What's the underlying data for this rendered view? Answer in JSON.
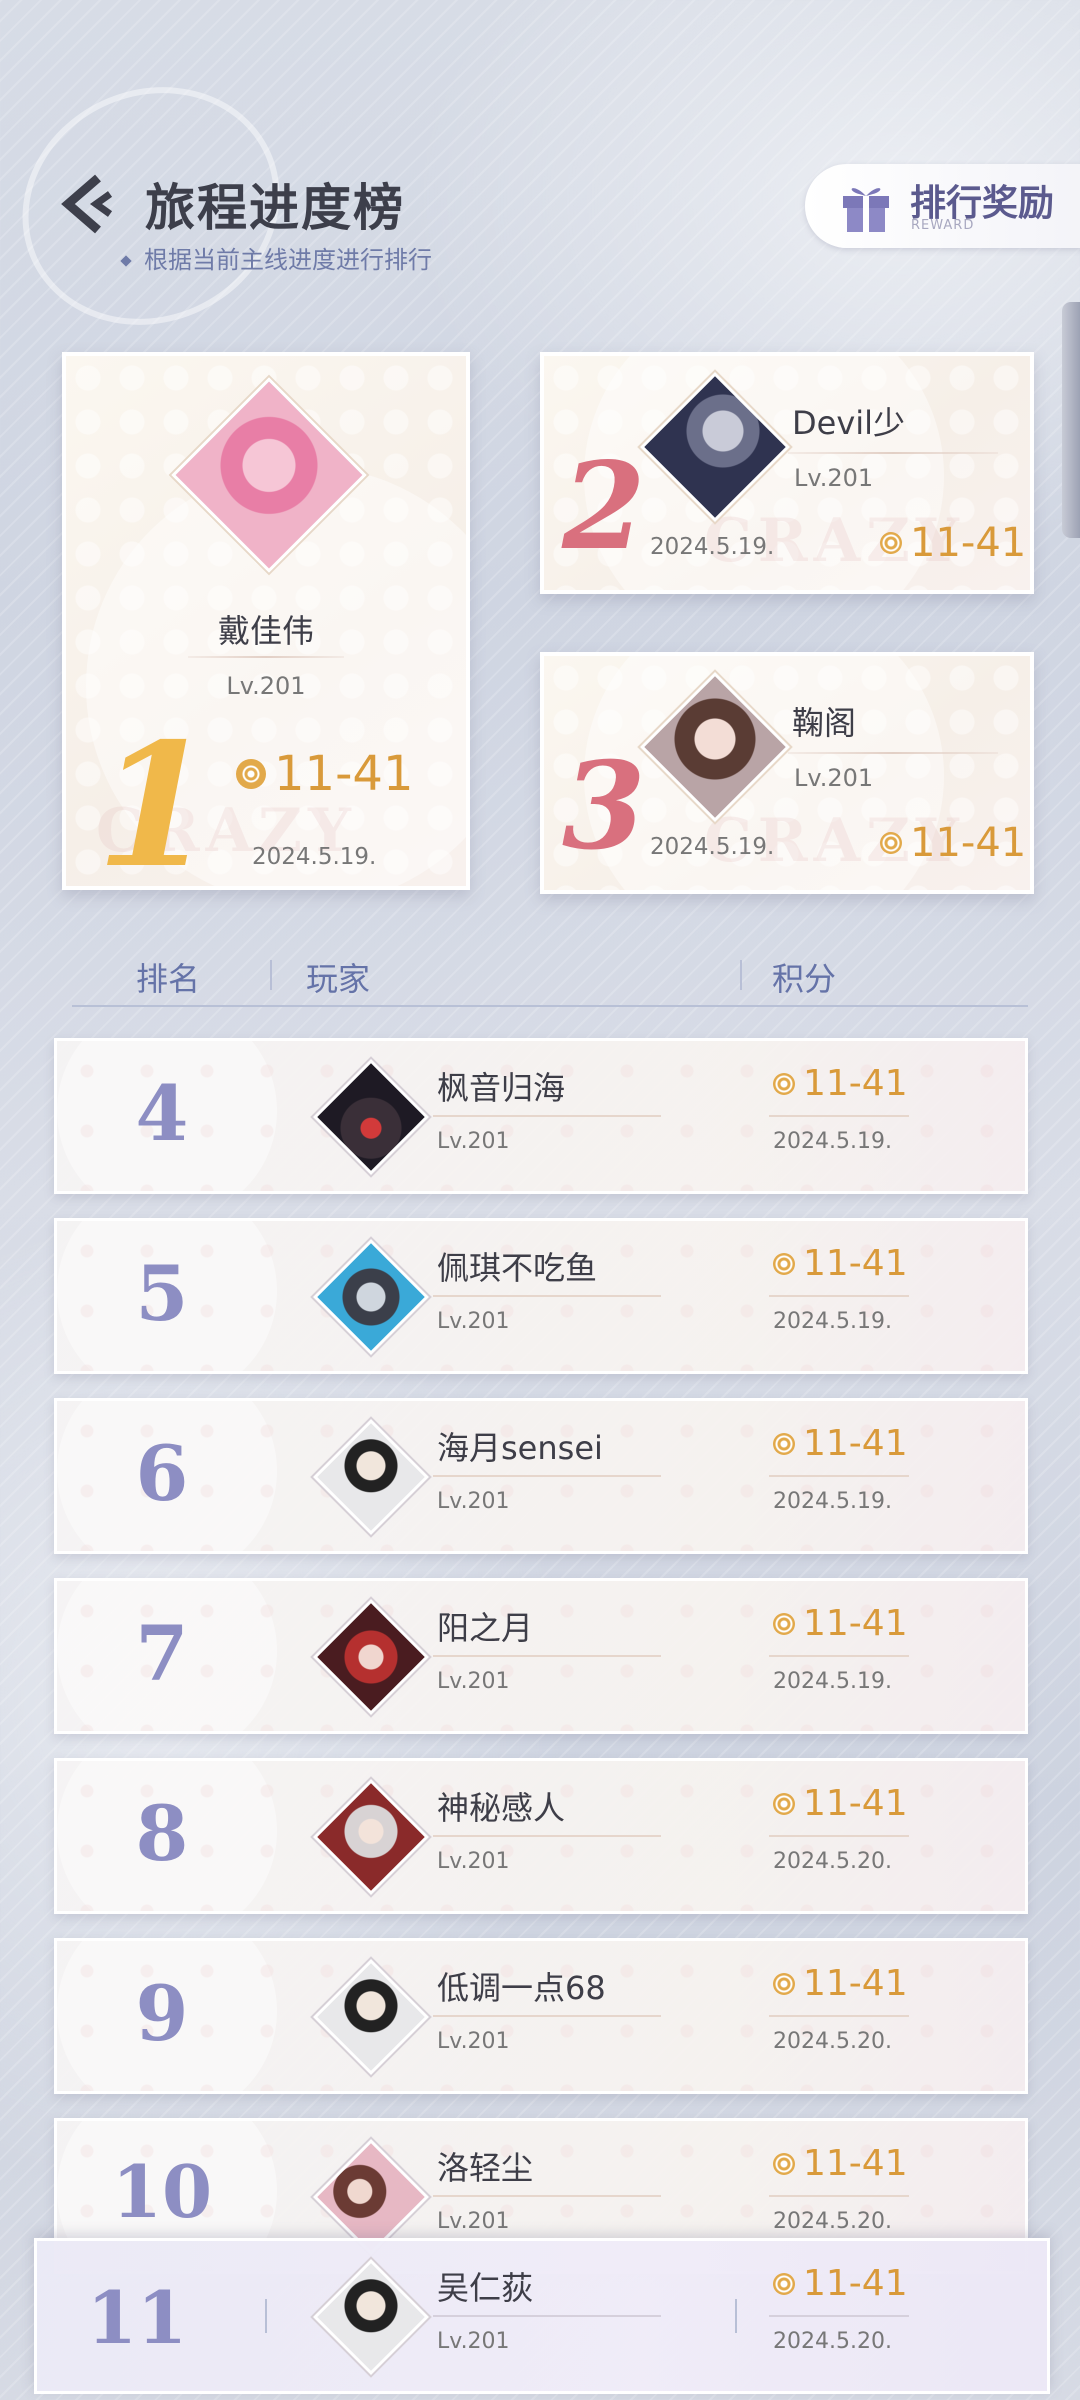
{
  "header": {
    "title": "旅程进度榜",
    "subtitle": "根据当前主线进度进行排行",
    "reward_label": "排行奖励",
    "reward_sub": "REWARD"
  },
  "podium": [
    {
      "rank": "1",
      "name": "戴佳伟",
      "level": "Lv.201",
      "score": "11-41",
      "date": "2024.5.19."
    },
    {
      "rank": "2",
      "name": "Devil少",
      "level": "Lv.201",
      "score": "11-41",
      "date": "2024.5.19."
    },
    {
      "rank": "3",
      "name": "鞠阁",
      "level": "Lv.201",
      "score": "11-41",
      "date": "2024.5.19."
    }
  ],
  "watermark": "CRAZY",
  "table_header": {
    "rank": "排名",
    "player": "玩家",
    "score": "积分"
  },
  "rows": [
    {
      "rank": "4",
      "name": "枫音归海",
      "level": "Lv.201",
      "score": "11-41",
      "date": "2024.5.19."
    },
    {
      "rank": "5",
      "name": "佩琪不吃鱼",
      "level": "Lv.201",
      "score": "11-41",
      "date": "2024.5.19."
    },
    {
      "rank": "6",
      "name": "海月sensei",
      "level": "Lv.201",
      "score": "11-41",
      "date": "2024.5.19."
    },
    {
      "rank": "7",
      "name": "阳之月",
      "level": "Lv.201",
      "score": "11-41",
      "date": "2024.5.19."
    },
    {
      "rank": "8",
      "name": "神秘感人",
      "level": "Lv.201",
      "score": "11-41",
      "date": "2024.5.20."
    },
    {
      "rank": "9",
      "name": "低调一点68",
      "level": "Lv.201",
      "score": "11-41",
      "date": "2024.5.20."
    },
    {
      "rank": "10",
      "name": "洛轻尘",
      "level": "Lv.201",
      "score": "11-41",
      "date": "2024.5.20."
    }
  ],
  "my_rank": {
    "rank": "11",
    "name": "吴仁荻",
    "level": "Lv.201",
    "score": "11-41",
    "date": "2024.5.20."
  },
  "colors": {
    "accent": "#6573a8",
    "score": "#d99a3a",
    "rank_gold": "#f0b84a",
    "rank_pink": "#d9707e",
    "rank_list": "#8d8ec3"
  },
  "icons": {
    "back": "back-chevron-icon",
    "reward": "gift-icon",
    "score": "coin-icon"
  }
}
